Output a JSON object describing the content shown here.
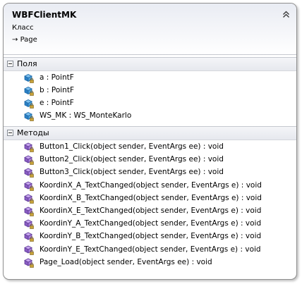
{
  "class_box": {
    "name": "WBFClientMK",
    "kind": "Класс",
    "base_prefix": "→",
    "base": "Page"
  },
  "sections": {
    "fields": {
      "title": "Поля",
      "items": [
        "a : PointF",
        "b : PointF",
        "e : PointF",
        "WS_MK : WS_MonteKarlo"
      ]
    },
    "methods": {
      "title": "Методы",
      "items": [
        "Button1_Click(object sender, EventArgs ee) : void",
        "Button2_Click(object sender, EventArgs ee) : void",
        "Button3_Click(object sender, EventArgs ee) : void",
        "KoordinX_A_TextChanged(object sender, EventArgs e) : void",
        "KoordinX_B_TextChanged(object sender, EventArgs e) : void",
        "KoordinX_E_TextChanged(object sender, EventArgs e) : void",
        "KoordinY_A_TextChanged(object sender, EventArgs e) : void",
        "KoordinY_B_TextChanged(object sender, EventArgs e) : void",
        "KoordinY_E_TextChanged(object sender, EventArgs e) : void",
        "Page_Load(object sender, EventArgs ee) : void"
      ]
    }
  },
  "icons": {
    "collapse": "double-chevron-up-icon",
    "field": "private-field-icon",
    "method": "private-method-icon",
    "section_toggle": "minus-box-icon"
  },
  "colors": {
    "field_icon": "#2a7fc4",
    "method_icon": "#8a5cc2",
    "lock": "#c7a23a"
  }
}
